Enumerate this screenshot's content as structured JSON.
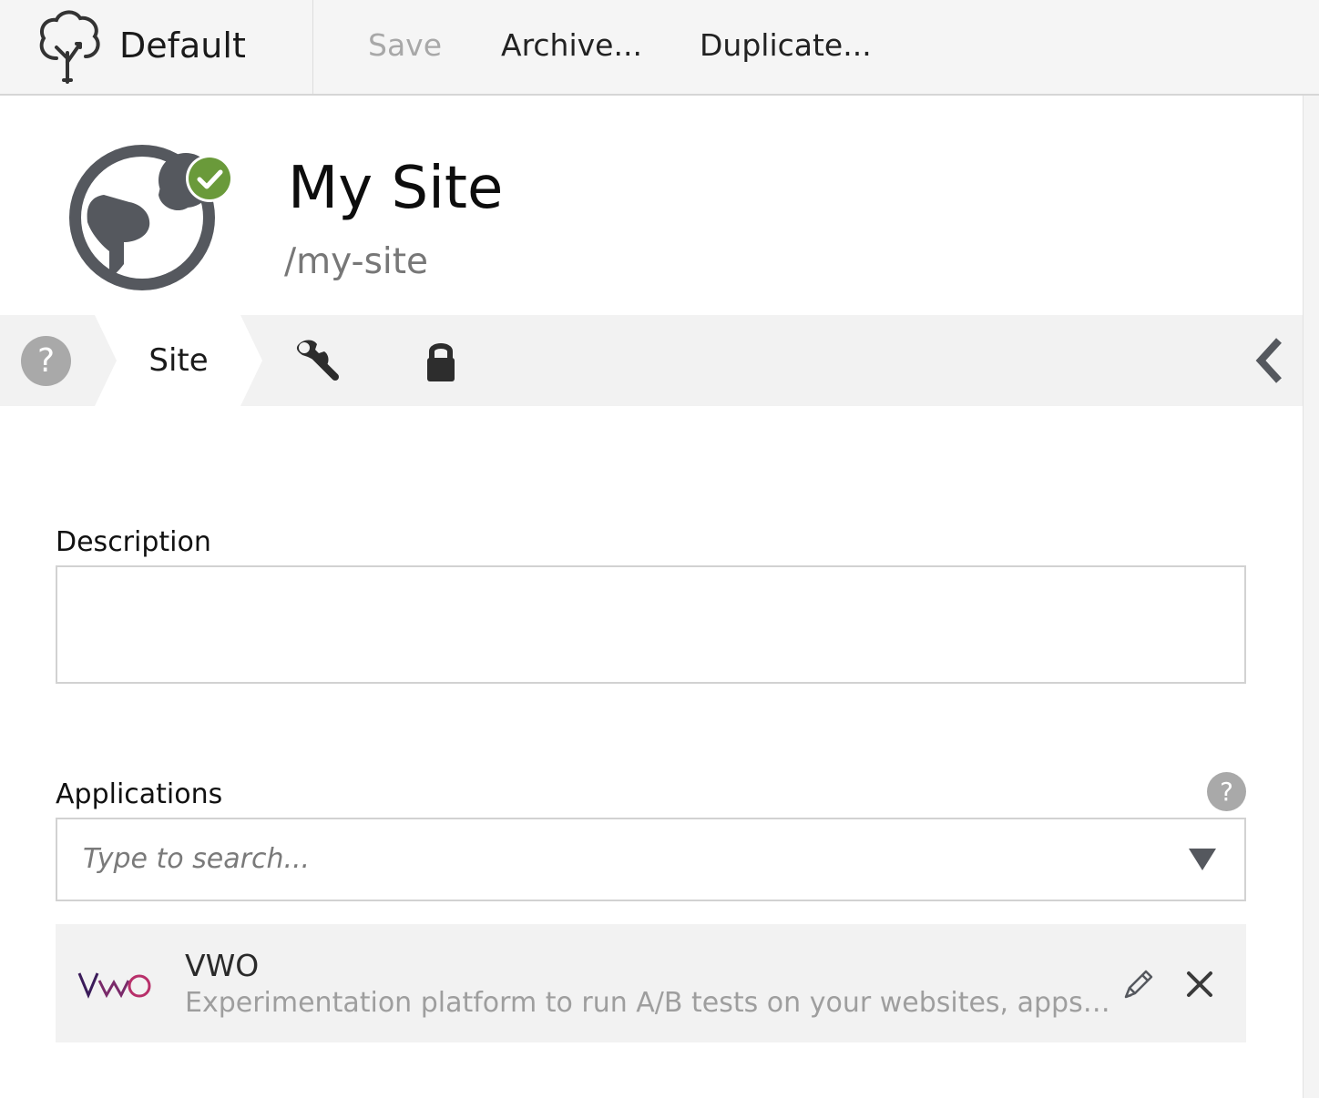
{
  "toolbar": {
    "brand_name": "Default",
    "brand_icon": "tree-icon",
    "save_label": "Save",
    "archive_label": "Archive...",
    "duplicate_label": "Duplicate..."
  },
  "header": {
    "icon": "globe-icon",
    "status_icon": "check-icon",
    "status_color": "#6a9a3a",
    "title": "My Site",
    "path": "/my-site"
  },
  "tabs": {
    "help_label": "?",
    "active_label": "Site",
    "items": [
      {
        "icon": "wrench-icon"
      },
      {
        "icon": "lock-icon"
      }
    ],
    "collapse_icon": "chevron-left-icon"
  },
  "form": {
    "description": {
      "label": "Description",
      "value": ""
    },
    "applications": {
      "label": "Applications",
      "help_label": "?",
      "search_placeholder": "Type to search...",
      "selected": [
        {
          "name": "VWO",
          "description": "Experimentation platform to run A/B tests on your websites, apps, and ...",
          "logo": "vwo-logo"
        }
      ]
    }
  },
  "colors": {
    "toolbar_bg": "#f5f5f5",
    "icon_gray": "#55585e",
    "help_gray": "#a9a9a9",
    "vwo_purple": "#3b1c5a",
    "vwo_pink": "#b8306a"
  }
}
